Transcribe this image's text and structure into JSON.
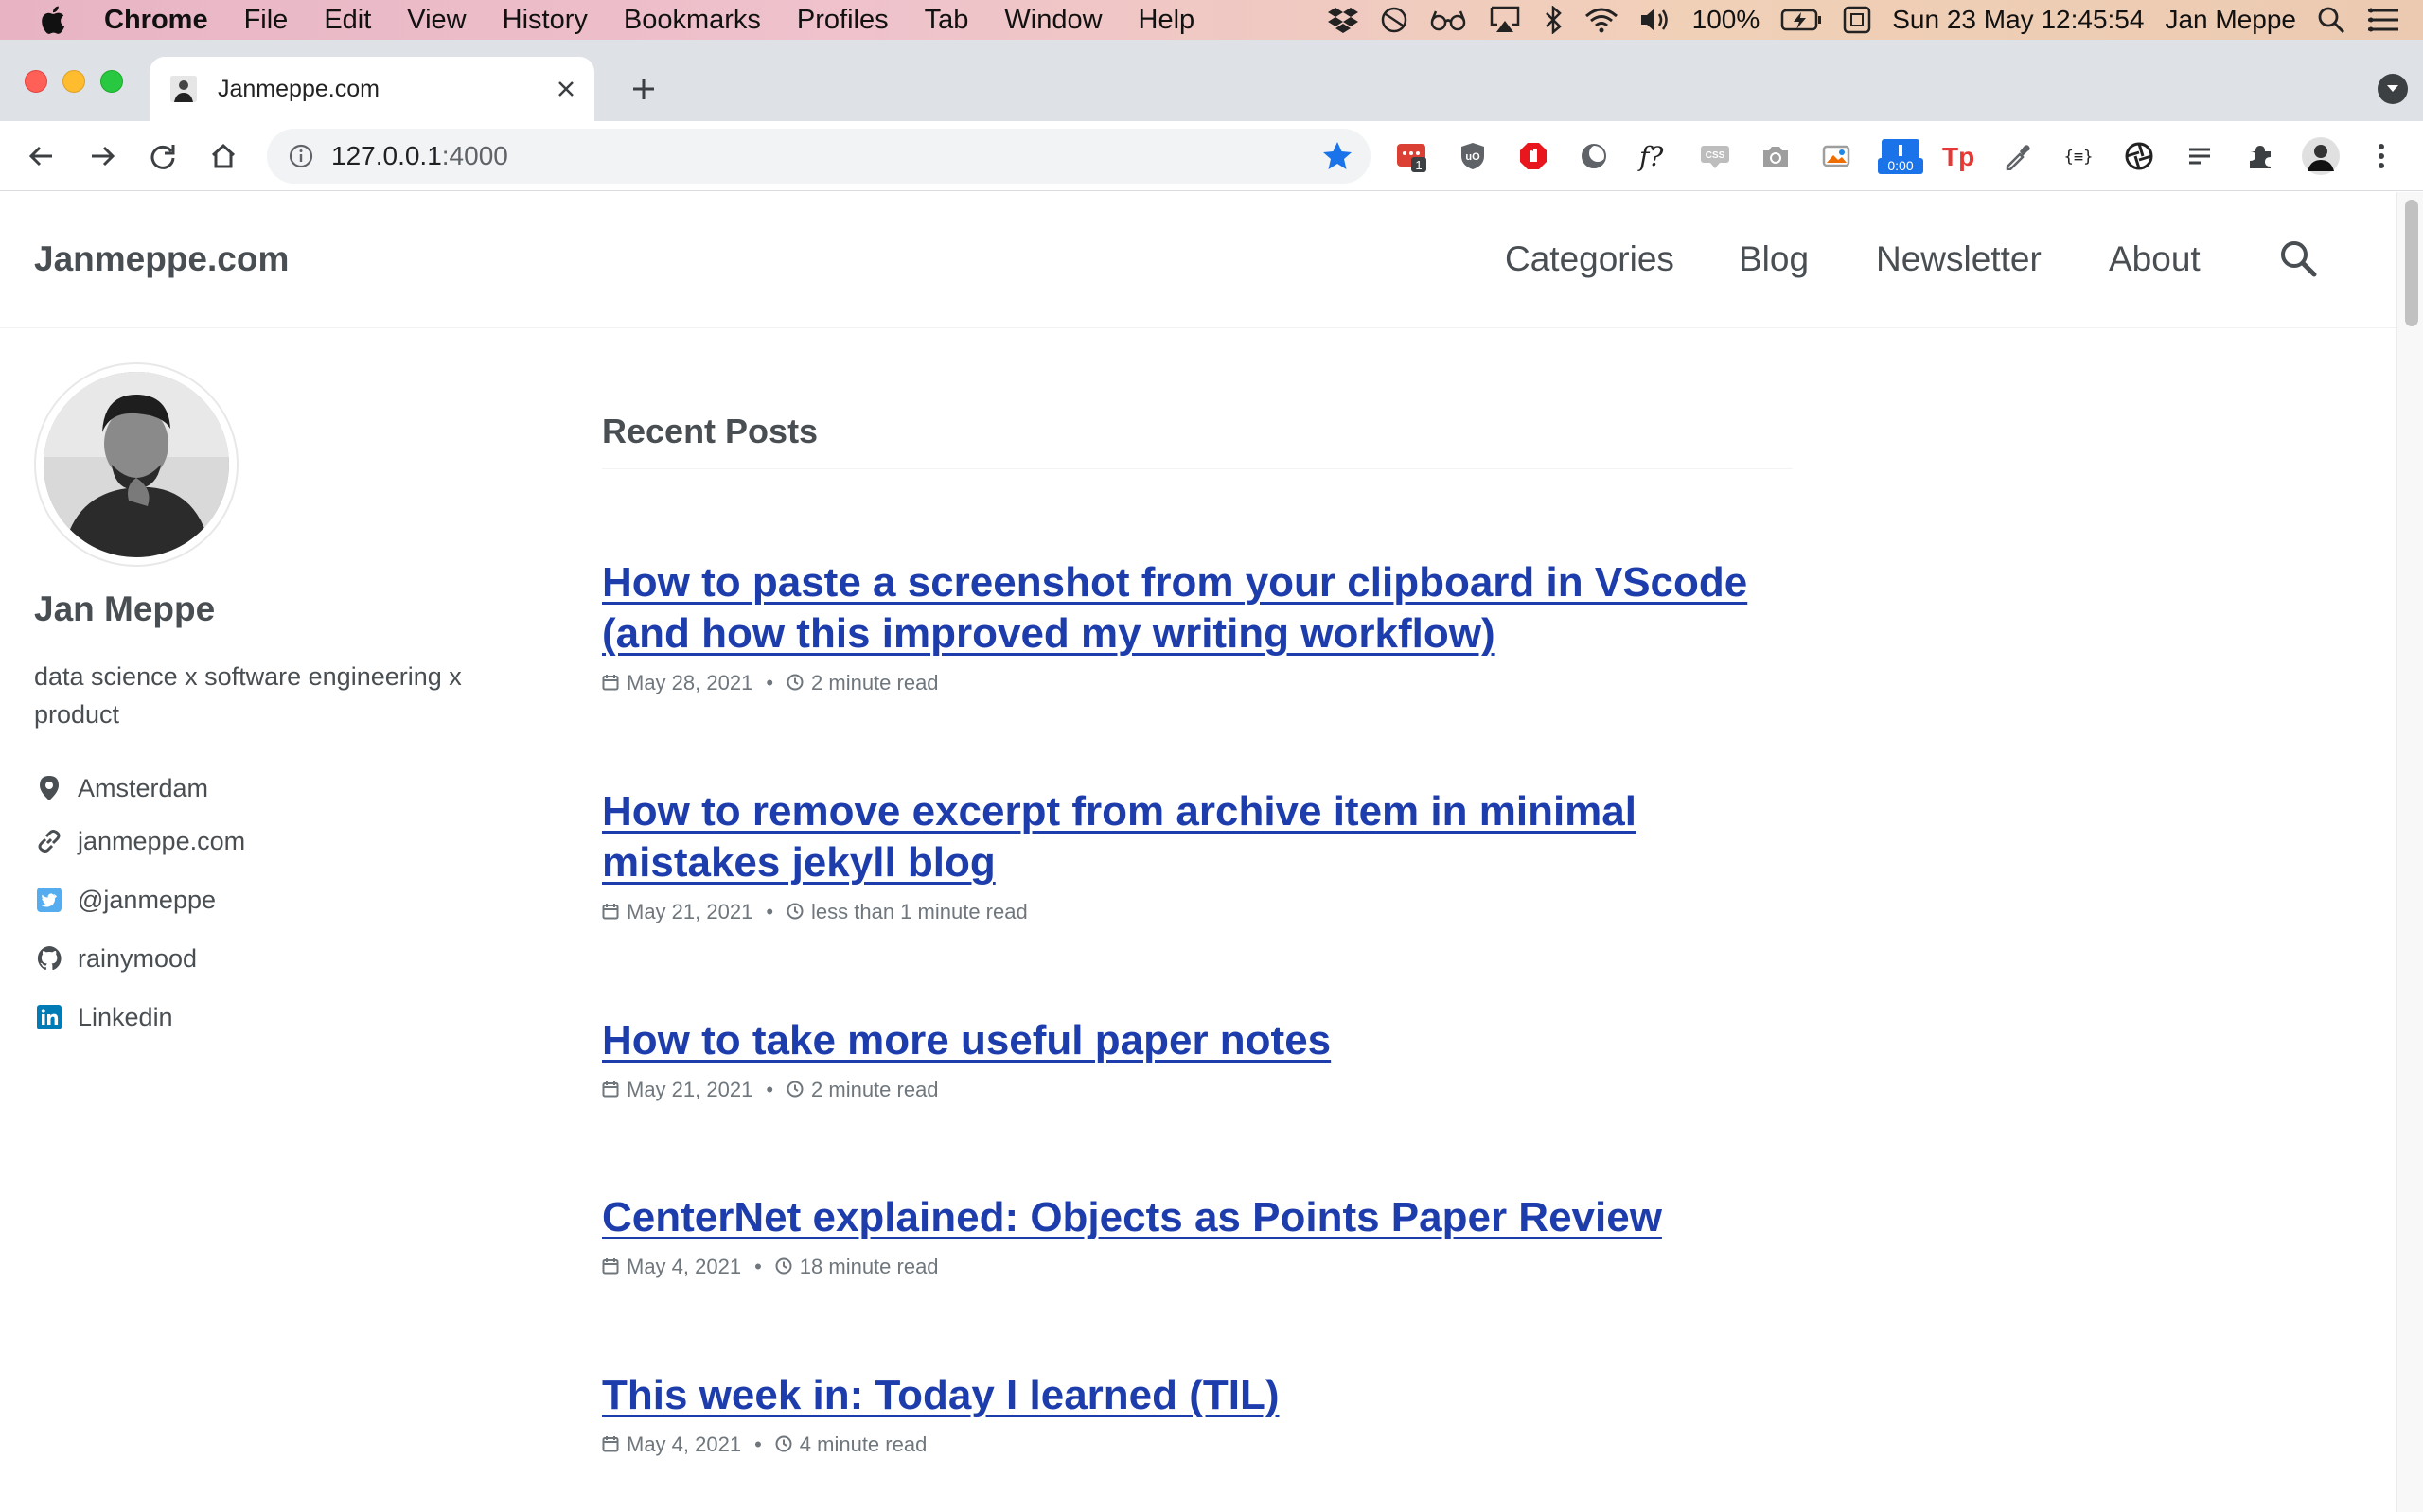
{
  "menubar": {
    "app_name": "Chrome",
    "items": [
      "File",
      "Edit",
      "View",
      "History",
      "Bookmarks",
      "Profiles",
      "Tab",
      "Window",
      "Help"
    ],
    "battery": "100%",
    "datetime": "Sun 23 May  12:45:54",
    "user": "Jan Meppe"
  },
  "browser": {
    "tab_title": "Janmeppe.com",
    "url_host": "127.0.0.1",
    "url_port": ":4000",
    "ext_badge": "1",
    "timer_badge": "0:00"
  },
  "site": {
    "title": "Janmeppe.com",
    "nav": [
      "Categories",
      "Blog",
      "Newsletter",
      "About"
    ]
  },
  "author": {
    "name": "Jan Meppe",
    "bio": "data science x software engineering x product",
    "links": [
      {
        "icon": "location-icon",
        "label": "Amsterdam"
      },
      {
        "icon": "link-icon",
        "label": "janmeppe.com"
      },
      {
        "icon": "twitter-icon",
        "label": "@janmeppe"
      },
      {
        "icon": "github-icon",
        "label": "rainymood"
      },
      {
        "icon": "linkedin-icon",
        "label": "Linkedin"
      }
    ]
  },
  "recent_posts": {
    "heading": "Recent Posts",
    "posts": [
      {
        "title": "How to paste a screenshot from your clipboard in VScode (and how this improved my writing workflow)",
        "date": "May 28, 2021",
        "read": "2 minute read"
      },
      {
        "title": "How to remove excerpt from archive item in minimal mistakes jekyll blog",
        "date": "May 21, 2021",
        "read": "less than 1 minute read"
      },
      {
        "title": "How to take more useful paper notes",
        "date": "May 21, 2021",
        "read": "2 minute read"
      },
      {
        "title": "CenterNet explained: Objects as Points Paper Review",
        "date": "May 4, 2021",
        "read": "18 minute read"
      },
      {
        "title": "This week in: Today I learned (TIL)",
        "date": "May 4, 2021",
        "read": "4 minute read"
      }
    ]
  },
  "colors": {
    "link": "#1e3dad",
    "text": "#494e52",
    "meta": "#6f777d",
    "twitter": "#55acee",
    "linkedin": "#007bb6"
  }
}
